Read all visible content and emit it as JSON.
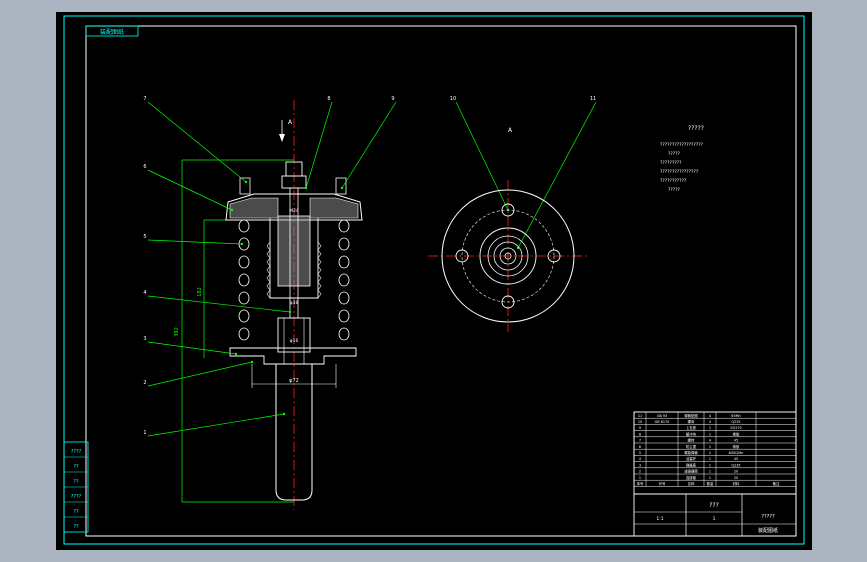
{
  "colors": {
    "app_background": "#abb5c2",
    "canvas": "#000000",
    "frame": "#ffffff",
    "title_block": "#00ffff",
    "leader": "#00ff00",
    "centerline": "#ff2020",
    "part_outline": "#ffffff",
    "hatch": "#b0b0b0"
  },
  "drawing": {
    "stamp": "装配图纸",
    "view_arrow": "A",
    "view_label": "A",
    "notes_title": "?????",
    "notes_lines": [
      "??????????????????",
      "?????",
      "?????????",
      "????????????????",
      "???????????",
      "?????"
    ],
    "part_numbers": [
      "1",
      "2",
      "3",
      "4",
      "5",
      "6",
      "7",
      "8",
      "9",
      "10",
      "11"
    ],
    "dimensions": {
      "shaft_dia": "φ16",
      "flange_width": "φ72",
      "seat_dia": "φ38",
      "thread": "M24",
      "spring_height": "182",
      "overall_height": "392"
    },
    "side_block": [
      "????",
      "??",
      "??",
      "????",
      "??",
      "??"
    ]
  },
  "title_block": {
    "bom_rows": [
      [
        "11",
        "GB 93",
        "弹簧垫圈",
        "4",
        "65Mn",
        ""
      ],
      [
        "10",
        "GB 6170",
        "螺母",
        "4",
        "Q235",
        ""
      ],
      [
        "9",
        "",
        "上支座",
        "1",
        "ZG270",
        ""
      ],
      [
        "8",
        "",
        "缓冲块",
        "1",
        "橡胶",
        ""
      ],
      [
        "7",
        "",
        "螺栓",
        "4",
        "45",
        ""
      ],
      [
        "6",
        "",
        "防尘罩",
        "1",
        "橡胶",
        ""
      ],
      [
        "5",
        "",
        "螺旋弹簧",
        "1",
        "60Si2Mn",
        ""
      ],
      [
        "4",
        "",
        "活塞杆",
        "1",
        "45",
        ""
      ],
      [
        "3",
        "",
        "弹簧座",
        "1",
        "Q235",
        ""
      ],
      [
        "2",
        "",
        "减振器筒",
        "1",
        "20",
        ""
      ],
      [
        "1",
        "",
        "连接管",
        "1",
        "20",
        ""
      ]
    ],
    "header_labels": [
      "序号",
      "代号",
      "名称",
      "数量",
      "材料",
      "备注"
    ],
    "drawing_name": "???",
    "school": "?????",
    "drawing_no": "装配图纸",
    "scale": "1:1",
    "sheet": "1"
  }
}
